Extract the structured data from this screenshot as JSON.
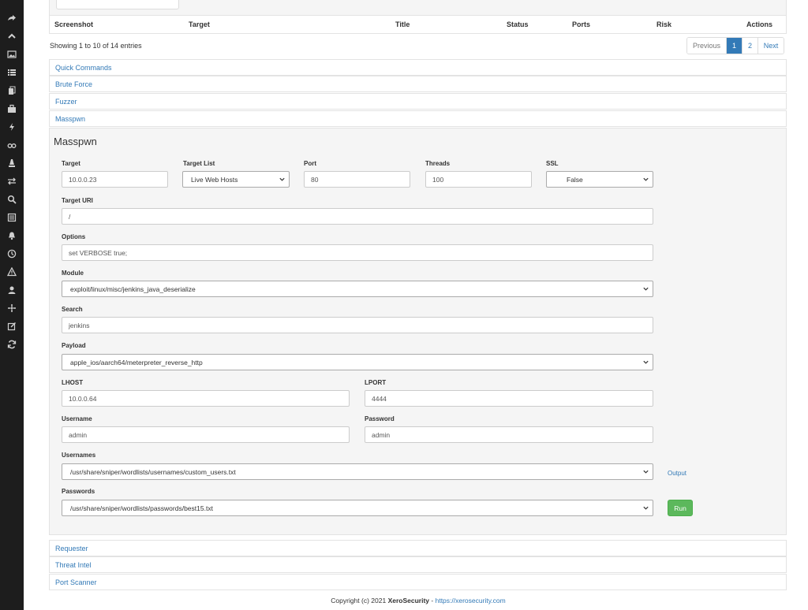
{
  "sidebar": {
    "icons": [
      "share-icon",
      "chevron-up-icon",
      "image-icon",
      "list-icon",
      "copy-icon",
      "briefcase-icon",
      "bolt-icon",
      "glasses-icon",
      "chess-icon",
      "exchange-icon",
      "search-icon",
      "newspaper-icon",
      "bell-icon",
      "clock-icon",
      "warning-icon",
      "user-icon",
      "crosshairs-icon",
      "edit-icon",
      "refresh-icon"
    ]
  },
  "table": {
    "headers": {
      "screenshot": "Screenshot",
      "target": "Target",
      "title": "Title",
      "status": "Status",
      "ports": "Ports",
      "risk": "Risk",
      "actions": "Actions"
    },
    "entries_info": "Showing 1 to 10 of 14 entries",
    "pagination": {
      "previous": "Previous",
      "pages": [
        "1",
        "2"
      ],
      "active_page": "1",
      "next": "Next"
    }
  },
  "panels": {
    "quick_commands": "Quick Commands",
    "brute_force": "Brute Force",
    "fuzzer": "Fuzzer",
    "masspwn": "Masspwn",
    "requester": "Requester",
    "threat_intel": "Threat Intel",
    "port_scanner": "Port Scanner"
  },
  "masspwn": {
    "heading": "Masspwn",
    "target": {
      "label": "Target",
      "value": "10.0.0.23"
    },
    "target_list": {
      "label": "Target List",
      "value": "Live Web Hosts"
    },
    "port": {
      "label": "Port",
      "value": "80"
    },
    "threads": {
      "label": "Threads",
      "value": "100"
    },
    "ssl": {
      "label": "SSL",
      "value": "False"
    },
    "target_uri": {
      "label": "Target URI",
      "value": "/"
    },
    "options": {
      "label": "Options",
      "value": "set VERBOSE true;"
    },
    "module": {
      "label": "Module",
      "value": "exploit/linux/misc/jenkins_java_deserialize"
    },
    "search": {
      "label": "Search",
      "value": "jenkins"
    },
    "payload": {
      "label": "Payload",
      "value": "apple_ios/aarch64/meterpreter_reverse_http"
    },
    "lhost": {
      "label": "LHOST",
      "value": "10.0.0.64"
    },
    "lport": {
      "label": "LPORT",
      "value": "4444"
    },
    "username": {
      "label": "Username",
      "value": "admin"
    },
    "password": {
      "label": "Password",
      "value": "admin"
    },
    "usernames": {
      "label": "Usernames",
      "value": "/usr/share/sniper/wordlists/usernames/custom_users.txt"
    },
    "passwords": {
      "label": "Passwords",
      "value": "/usr/share/sniper/wordlists/passwords/best15.txt"
    },
    "output_link": "Output",
    "run_button": "Run"
  },
  "footer": {
    "prefix": "Copyright (c) 2021",
    "brand": "XeroSecurity",
    "separator": "-",
    "url": "https://xerosecurity.com"
  },
  "colors": {
    "sidebar_bg": "#1d1d1d",
    "link": "#337ab7",
    "run_button": "#5cb85c",
    "panel_bg": "#f5f5f5"
  }
}
